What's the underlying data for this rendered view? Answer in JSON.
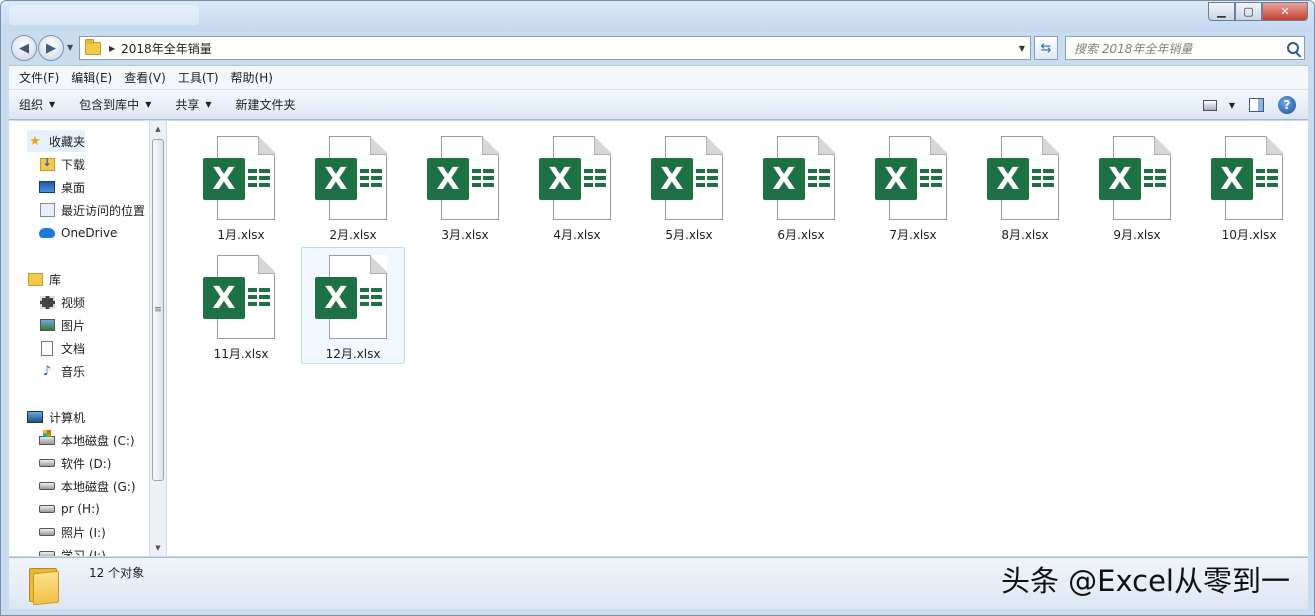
{
  "window": {
    "controls": {
      "minimize": "▁",
      "maximize": "▢",
      "close": "✕"
    }
  },
  "address": {
    "crumb": "2018年全年销量",
    "search_placeholder": "搜索 2018年全年销量"
  },
  "menu": [
    "文件(F)",
    "编辑(E)",
    "查看(V)",
    "工具(T)",
    "帮助(H)"
  ],
  "commands": {
    "organize": "组织",
    "include_library": "包含到库中",
    "share": "共享",
    "new_folder": "新建文件夹",
    "help": "?"
  },
  "nav": {
    "favorites": "收藏夹",
    "downloads": "下载",
    "desktop": "桌面",
    "recent": "最近访问的位置",
    "onedrive": "OneDrive",
    "libraries": "库",
    "videos": "视频",
    "pictures": "图片",
    "documents": "文档",
    "music": "音乐",
    "computer": "计算机",
    "drive_c": "本地磁盘 (C:)",
    "drive_d": "软件 (D:)",
    "drive_g": "本地磁盘 (G:)",
    "drive_h": "pr (H:)",
    "drive_i": "照片 (I:)",
    "drive_j": "学习 (J:)"
  },
  "files": [
    {
      "name": "1月.xlsx"
    },
    {
      "name": "2月.xlsx"
    },
    {
      "name": "3月.xlsx"
    },
    {
      "name": "4月.xlsx"
    },
    {
      "name": "5月.xlsx"
    },
    {
      "name": "6月.xlsx"
    },
    {
      "name": "7月.xlsx"
    },
    {
      "name": "8月.xlsx"
    },
    {
      "name": "9月.xlsx"
    },
    {
      "name": "10月.xlsx"
    },
    {
      "name": "11月.xlsx"
    },
    {
      "name": "12月.xlsx"
    }
  ],
  "file_badge": "X",
  "selected_file": "12月.xlsx",
  "status": {
    "count": "12 个对象"
  },
  "watermark": "头条 @Excel从零到一",
  "colors": {
    "excel_green": "#1e7145",
    "selection": "#f0f7fe"
  }
}
